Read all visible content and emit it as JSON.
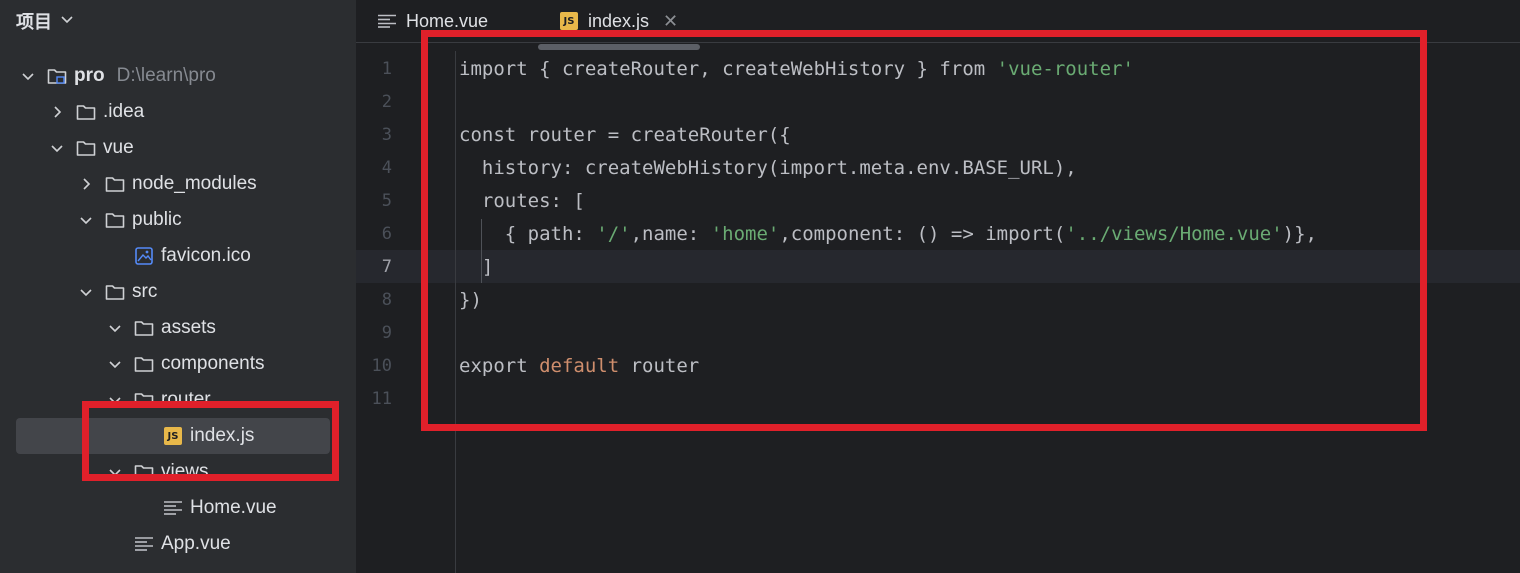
{
  "sidebar": {
    "title": "项目",
    "tree": [
      {
        "label": "pro",
        "extra": "D:\\learn\\pro",
        "icon": "project-folder-icon",
        "expanded": true
      },
      {
        "label": ".idea",
        "icon": "folder-icon",
        "expanded": false
      },
      {
        "label": "vue",
        "icon": "folder-icon",
        "expanded": true
      },
      {
        "label": "node_modules",
        "icon": "folder-icon",
        "expanded": false
      },
      {
        "label": "public",
        "icon": "folder-icon",
        "expanded": true
      },
      {
        "label": "favicon.ico",
        "icon": "image-file-icon"
      },
      {
        "label": "src",
        "icon": "folder-icon",
        "expanded": true
      },
      {
        "label": "assets",
        "icon": "folder-icon",
        "expanded": true
      },
      {
        "label": "components",
        "icon": "folder-icon",
        "expanded": true
      },
      {
        "label": "router",
        "icon": "folder-icon",
        "expanded": true
      },
      {
        "label": "index.js",
        "icon": "js-file-icon",
        "selected": true
      },
      {
        "label": "views",
        "icon": "folder-icon",
        "expanded": true
      },
      {
        "label": "Home.vue",
        "icon": "vue-file-icon"
      },
      {
        "label": "App.vue",
        "icon": "vue-file-icon"
      }
    ]
  },
  "tabs": [
    {
      "label": "Home.vue",
      "icon": "vue-file-icon"
    },
    {
      "label": "index.js",
      "icon": "js-file-icon",
      "active": true,
      "close": "✕"
    }
  ],
  "js_badge": "JS",
  "editor": {
    "current_line": 7,
    "line_numbers": [
      "1",
      "2",
      "3",
      "4",
      "5",
      "6",
      "7",
      "8",
      "9",
      "10",
      "11"
    ],
    "lines": [
      [
        [
          "t",
          "import { createRouter, createWebHistory } from "
        ],
        [
          "s",
          "'vue-router'"
        ]
      ],
      [],
      [
        [
          "t",
          "const router = createRouter({"
        ]
      ],
      [
        [
          "t",
          "  history: createWebHistory(import.meta.env.BASE_URL),"
        ]
      ],
      [
        [
          "t",
          "  routes: ["
        ]
      ],
      [
        [
          "t",
          "    { path: "
        ],
        [
          "s",
          "'/'"
        ],
        [
          "t",
          ",name: "
        ],
        [
          "s",
          "'home'"
        ],
        [
          "t",
          ",component: () => import("
        ],
        [
          "s",
          "'../views/Home.vue'"
        ],
        [
          "t",
          ")},"
        ]
      ],
      [
        [
          "t",
          "  ]"
        ]
      ],
      [
        [
          "t",
          "})"
        ]
      ],
      [],
      [
        [
          "t",
          "export "
        ],
        [
          "k",
          "default"
        ],
        [
          "t",
          " router"
        ]
      ],
      []
    ]
  },
  "colors": {
    "highlight_box": "#e0202a",
    "string": "#6aab73",
    "keyword": "#cf8e6d",
    "text": "#bcbec4",
    "js_badge": "#e8b84a"
  }
}
